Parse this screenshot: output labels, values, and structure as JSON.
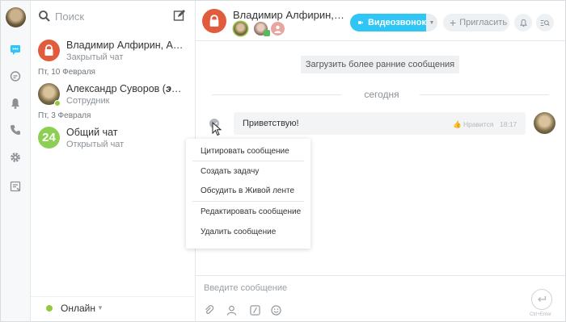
{
  "colors": {
    "accent": "#2fc6f6",
    "lock": "#e15c3d",
    "online": "#94c93d",
    "avatar_green": "#8ccf52"
  },
  "sidebar": {
    "search_placeholder": "Поиск",
    "chats": [
      {
        "title": "Владимир Алфирин, Алекс...",
        "subtitle": "Закрытый чат",
        "avatar": "lock-icon"
      },
      {
        "date": "Пт, 10 Февраля",
        "title_prefix": "Александр Суворов (",
        "title_italic": "это в...",
        "subtitle": "Сотрудник",
        "avatar": "photo"
      },
      {
        "date": "Пт, 3 Февраля",
        "title": "Общий чат",
        "subtitle": "Открытый чат",
        "avatar_text": "24"
      }
    ],
    "status": "Онлайн"
  },
  "header": {
    "title": "Владимир Алфирин, Але...",
    "video_label": "Видеозвонок",
    "invite_label": "Пригласить"
  },
  "chat": {
    "load_earlier": "Загрузить более ранние сообщения",
    "day_label": "сегодня",
    "message": {
      "text": "Приветствую!",
      "like": "Нравится",
      "time": "18:17"
    }
  },
  "context_menu": [
    "Цитировать сообщение",
    "Создать задачу",
    "Обсудить в Живой ленте",
    "Редактировать сообщение",
    "Удалить сообщение"
  ],
  "composer": {
    "placeholder": "Введите сообщение",
    "send_hint": "Ctrl+Enter"
  }
}
